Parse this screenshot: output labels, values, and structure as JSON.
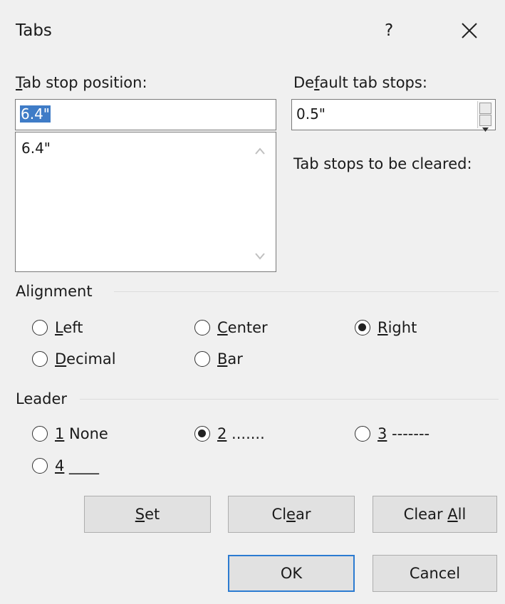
{
  "dialog": {
    "title": "Tabs",
    "help": "?"
  },
  "tab_stop": {
    "label_u": "T",
    "label_rest": "ab stop position:",
    "value": "6.4\"",
    "list": [
      "6.4\""
    ]
  },
  "default_tabs": {
    "label_pre": "De",
    "label_u": "f",
    "label_rest": "ault tab stops:",
    "value": "0.5\""
  },
  "cleared": {
    "label": "Tab stops to be cleared:"
  },
  "alignment": {
    "label": "Alignment",
    "options": [
      {
        "u": "L",
        "rest": "eft",
        "selected": false
      },
      {
        "u": "C",
        "rest": "enter",
        "selected": false
      },
      {
        "u": "R",
        "rest": "ight",
        "selected": true
      },
      {
        "u": "D",
        "rest": "ecimal",
        "selected": false
      },
      {
        "u": "B",
        "rest": "ar",
        "selected": false
      }
    ]
  },
  "leader": {
    "label": "Leader",
    "options": [
      {
        "u": "1",
        "rest": " None",
        "selected": false
      },
      {
        "u": "2",
        "rest": " .......",
        "selected": true
      },
      {
        "u": "3",
        "rest": " -------",
        "selected": false
      },
      {
        "u": "4",
        "rest": " ____",
        "selected": false
      }
    ]
  },
  "buttons": {
    "set_u": "S",
    "set_rest": "et",
    "clear_pre": "Cl",
    "clear_u": "e",
    "clear_rest": "ar",
    "clearall_pre": "Clear ",
    "clearall_u": "A",
    "clearall_rest": "ll",
    "ok": "OK",
    "cancel": "Cancel"
  }
}
